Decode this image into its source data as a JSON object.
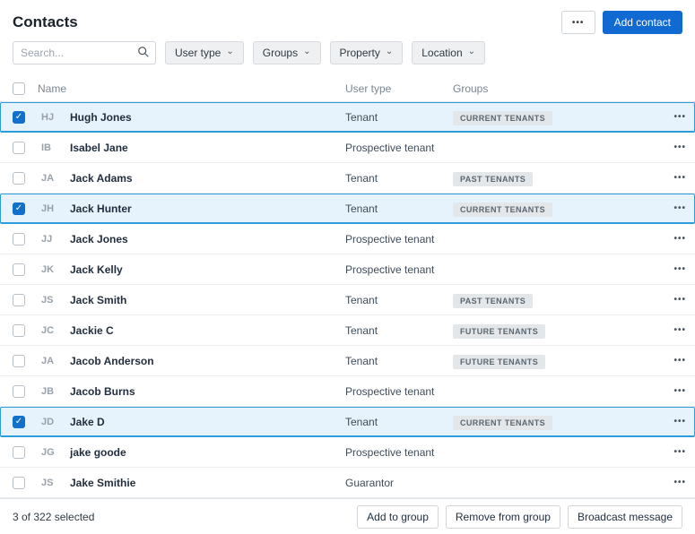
{
  "page": {
    "title": "Contacts"
  },
  "topbar": {
    "more_label": "•••",
    "add_contact_label": "Add contact"
  },
  "filters": {
    "search_placeholder": "Search...",
    "items": [
      {
        "label": "User type"
      },
      {
        "label": "Groups"
      },
      {
        "label": "Property"
      },
      {
        "label": "Location"
      }
    ]
  },
  "table": {
    "columns": {
      "name": "Name",
      "user_type": "User type",
      "groups": "Groups"
    },
    "rows": [
      {
        "initials": "HJ",
        "name": "Hugh Jones",
        "user_type": "Tenant",
        "group": "CURRENT TENANTS",
        "selected": true
      },
      {
        "initials": "IB",
        "name": "Isabel Jane",
        "user_type": "Prospective tenant",
        "group": "",
        "selected": false
      },
      {
        "initials": "JA",
        "name": "Jack Adams",
        "user_type": "Tenant",
        "group": "PAST TENANTS",
        "selected": false
      },
      {
        "initials": "JH",
        "name": "Jack Hunter",
        "user_type": "Tenant",
        "group": "CURRENT TENANTS",
        "selected": true
      },
      {
        "initials": "JJ",
        "name": "Jack Jones",
        "user_type": "Prospective tenant",
        "group": "",
        "selected": false
      },
      {
        "initials": "JK",
        "name": "Jack Kelly",
        "user_type": "Prospective tenant",
        "group": "",
        "selected": false
      },
      {
        "initials": "JS",
        "name": "Jack Smith",
        "user_type": "Tenant",
        "group": "PAST TENANTS",
        "selected": false
      },
      {
        "initials": "JC",
        "name": "Jackie C",
        "user_type": "Tenant",
        "group": "FUTURE TENANTS",
        "selected": false
      },
      {
        "initials": "JA",
        "name": "Jacob Anderson",
        "user_type": "Tenant",
        "group": "FUTURE TENANTS",
        "selected": false
      },
      {
        "initials": "JB",
        "name": "Jacob Burns",
        "user_type": "Prospective tenant",
        "group": "",
        "selected": false
      },
      {
        "initials": "JD",
        "name": "Jake D",
        "user_type": "Tenant",
        "group": "CURRENT TENANTS",
        "selected": true
      },
      {
        "initials": "JG",
        "name": "jake goode",
        "user_type": "Prospective tenant",
        "group": "",
        "selected": false
      },
      {
        "initials": "JS",
        "name": "Jake Smithie",
        "user_type": "Guarantor",
        "group": "",
        "selected": false
      }
    ]
  },
  "footer": {
    "selection_text": "3 of 322 selected",
    "actions": [
      "Add to group",
      "Remove from group",
      "Broadcast message"
    ]
  },
  "colors": {
    "accent_blue": "#1169d2",
    "selected_row_bg": "#e7f3fc",
    "selected_row_border": "#2d9cdb",
    "badge_bg": "#e4e7ea"
  }
}
